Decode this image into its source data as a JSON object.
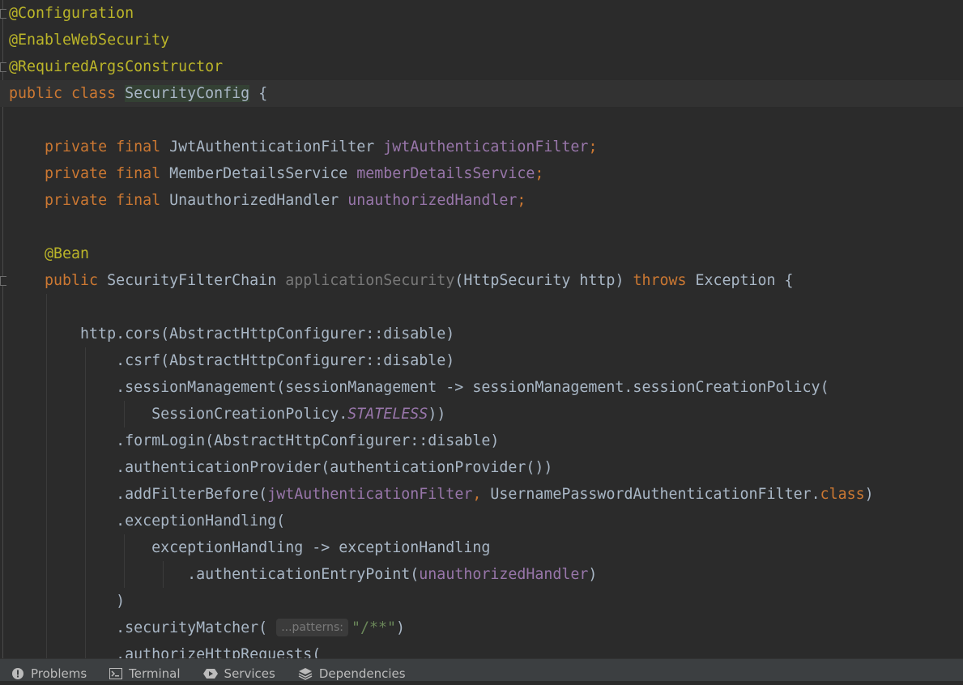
{
  "editor": {
    "lines": [
      {
        "tokens": [
          [
            "ann",
            "@Configuration"
          ]
        ]
      },
      {
        "tokens": [
          [
            "ann",
            "@EnableWebSecurity"
          ]
        ]
      },
      {
        "tokens": [
          [
            "ann",
            "@RequiredArgsConstructor"
          ]
        ]
      },
      {
        "tokens": [
          [
            "kw",
            "public "
          ],
          [
            "kw",
            "class "
          ],
          [
            "hl-class",
            "SecurityConfig"
          ],
          [
            "cls",
            " {"
          ]
        ],
        "current": true
      },
      {
        "tokens": []
      },
      {
        "tokens": [
          [
            "cls",
            "    "
          ],
          [
            "kw",
            "private "
          ],
          [
            "kw",
            "final "
          ],
          [
            "cls",
            "JwtAuthenticationFilter "
          ],
          [
            "field",
            "jwtAuthenticationFilter"
          ],
          [
            "semi",
            ";"
          ]
        ]
      },
      {
        "tokens": [
          [
            "cls",
            "    "
          ],
          [
            "kw",
            "private "
          ],
          [
            "kw",
            "final "
          ],
          [
            "cls",
            "MemberDetailsService "
          ],
          [
            "field",
            "memberDetailsService"
          ],
          [
            "semi",
            ";"
          ]
        ]
      },
      {
        "tokens": [
          [
            "cls",
            "    "
          ],
          [
            "kw",
            "private "
          ],
          [
            "kw",
            "final "
          ],
          [
            "cls",
            "UnauthorizedHandler "
          ],
          [
            "field",
            "unauthorizedHandler"
          ],
          [
            "semi",
            ";"
          ]
        ]
      },
      {
        "tokens": []
      },
      {
        "tokens": [
          [
            "cls",
            "    "
          ],
          [
            "ann",
            "@Bean"
          ]
        ]
      },
      {
        "tokens": [
          [
            "cls",
            "    "
          ],
          [
            "kw",
            "public "
          ],
          [
            "cls",
            "SecurityFilterChain "
          ],
          [
            "unused",
            "applicationSecurity"
          ],
          [
            "cls",
            "(HttpSecurity http) "
          ],
          [
            "kw",
            "throws "
          ],
          [
            "cls",
            "Exception {"
          ]
        ]
      },
      {
        "tokens": []
      },
      {
        "tokens": [
          [
            "cls",
            "        http.cors(AbstractHttpConfigurer::disable)"
          ]
        ]
      },
      {
        "tokens": [
          [
            "cls",
            "            .csrf(AbstractHttpConfigurer::disable)"
          ]
        ]
      },
      {
        "tokens": [
          [
            "cls",
            "            .sessionManagement(sessionManagement -> sessionManagement.sessionCreationPolicy("
          ]
        ]
      },
      {
        "tokens": [
          [
            "cls",
            "                SessionCreationPolicy."
          ],
          [
            "static-italic",
            "STATELESS"
          ],
          [
            "cls",
            "))"
          ]
        ]
      },
      {
        "tokens": [
          [
            "cls",
            "            .formLogin(AbstractHttpConfigurer::disable)"
          ]
        ]
      },
      {
        "tokens": [
          [
            "cls",
            "            .authenticationProvider(authenticationProvider())"
          ]
        ]
      },
      {
        "tokens": [
          [
            "cls",
            "            .addFilterBefore("
          ],
          [
            "field",
            "jwtAuthenticationFilter"
          ],
          [
            "semi",
            ", "
          ],
          [
            "cls",
            "UsernamePasswordAuthenticationFilter."
          ],
          [
            "kw",
            "class"
          ],
          [
            "cls",
            ")"
          ]
        ]
      },
      {
        "tokens": [
          [
            "cls",
            "            .exceptionHandling("
          ]
        ]
      },
      {
        "tokens": [
          [
            "cls",
            "                exceptionHandling -> exceptionHandling"
          ]
        ]
      },
      {
        "tokens": [
          [
            "cls",
            "                    .authenticationEntryPoint("
          ],
          [
            "field",
            "unauthorizedHandler"
          ],
          [
            "cls",
            ")"
          ]
        ]
      },
      {
        "tokens": [
          [
            "cls",
            "            )"
          ]
        ]
      },
      {
        "tokens": [
          [
            "cls",
            "            .securityMatcher( "
          ],
          [
            "hint",
            "...patterns:"
          ],
          [
            "str",
            "\"/**\""
          ],
          [
            "cls",
            ")"
          ]
        ]
      },
      {
        "tokens": [
          [
            "cls",
            "            .authorizeHttpRequests("
          ]
        ]
      }
    ]
  },
  "toolwindows": [
    {
      "label": "Problems",
      "icon": "problems-icon"
    },
    {
      "label": "Terminal",
      "icon": "terminal-icon"
    },
    {
      "label": "Services",
      "icon": "services-icon"
    },
    {
      "label": "Dependencies",
      "icon": "dependencies-icon"
    }
  ]
}
